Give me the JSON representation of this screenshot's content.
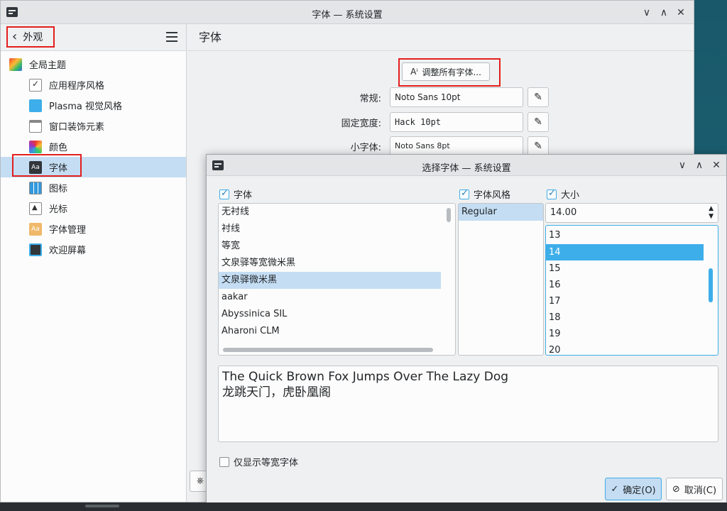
{
  "main_window": {
    "title": "字体 — 系统设置",
    "controls": [
      "∨",
      "∧",
      "✕"
    ]
  },
  "sidebar": {
    "back_label": "外观",
    "items": [
      {
        "label": "全局主题",
        "icon": "global-theme-icon"
      },
      {
        "label": "应用程序风格",
        "icon": "application-style-icon"
      },
      {
        "label": "Plasma 视觉风格",
        "icon": "plasma-style-icon"
      },
      {
        "label": "窗口装饰元素",
        "icon": "window-decoration-icon"
      },
      {
        "label": "颜色",
        "icon": "colors-icon"
      },
      {
        "label": "字体",
        "icon": "fonts-icon",
        "active": true
      },
      {
        "label": "图标",
        "icon": "icons-icon"
      },
      {
        "label": "光标",
        "icon": "cursor-icon"
      },
      {
        "label": "字体管理",
        "icon": "font-manager-icon"
      },
      {
        "label": "欢迎屏幕",
        "icon": "splash-screen-icon"
      }
    ]
  },
  "content": {
    "title": "字体",
    "adjust_all_label": "调整所有字体...",
    "rows": [
      {
        "label": "常规:",
        "value": "Noto Sans 10pt"
      },
      {
        "label": "固定宽度:",
        "value": "Hack 10pt"
      },
      {
        "label": "小字体:",
        "value": "Noto Sans 8pt"
      }
    ]
  },
  "dialog": {
    "title": "选择字体 — 系统设置",
    "font_label": "字体",
    "style_label": "字体风格",
    "size_label": "大小",
    "fonts": [
      "无衬线",
      "衬线",
      "等宽",
      "文泉驿等宽微米黑",
      "文泉驿微米黑",
      "aakar",
      "Abyssinica SIL",
      "Aharoni CLM"
    ],
    "selected_font": "文泉驿微米黑",
    "styles": [
      "Regular"
    ],
    "size_value": "14.00",
    "sizes": [
      "13",
      "14",
      "15",
      "16",
      "17",
      "18",
      "19",
      "20"
    ],
    "selected_size": "14",
    "preview_line1": "The Quick Brown Fox Jumps Over The Lazy Dog",
    "preview_line2": "龙跳天门，虎卧凰阁",
    "monospace_only_label": "仅显示等宽字体",
    "ok_label": "确定(O)",
    "cancel_label": "取消(C)"
  },
  "colors": {
    "accent": "#3daee9",
    "selection": "#c4ddf3",
    "highlight_box": "#e41e1e"
  }
}
